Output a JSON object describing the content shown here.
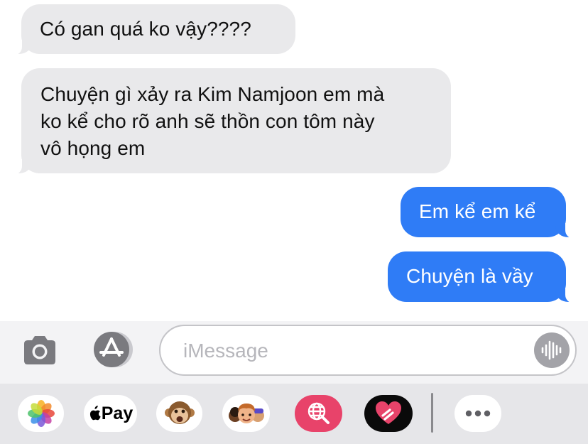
{
  "messages": [
    {
      "direction": "received",
      "text": "Có gan quá ko vậy????"
    },
    {
      "direction": "received",
      "lines": [
        "Chuyện gì xảy ra Kim Namjoon em mà",
        "ko kể cho rõ anh sẽ thồn con tôm này",
        "vô họng em"
      ]
    },
    {
      "direction": "sent",
      "text": "Em kể em kể"
    },
    {
      "direction": "sent",
      "text": "Chuyện là vầy"
    }
  ],
  "composer": {
    "placeholder": "iMessage",
    "camera_icon": "camera-icon",
    "apps_icon": "app-store-icon",
    "audio_icon": "waveform-icon"
  },
  "app_drawer": {
    "apps": [
      {
        "name": "photos",
        "icon": "photos-icon"
      },
      {
        "name": "apple-pay",
        "icon": "apple-logo-icon",
        "label": "Pay"
      },
      {
        "name": "animoji",
        "icon": "monkey-icon"
      },
      {
        "name": "memoji",
        "icon": "memoji-icon"
      },
      {
        "name": "image-search",
        "icon": "globe-search-icon"
      },
      {
        "name": "digital-touch",
        "icon": "heart-icon"
      },
      {
        "name": "more",
        "icon": "more-icon"
      }
    ]
  },
  "colors": {
    "sent_bubble": "#2f7cf6",
    "received_bubble": "#e9e9eb",
    "composer_bg": "#f3f3f5",
    "drawer_bg": "#e6e6e9"
  }
}
